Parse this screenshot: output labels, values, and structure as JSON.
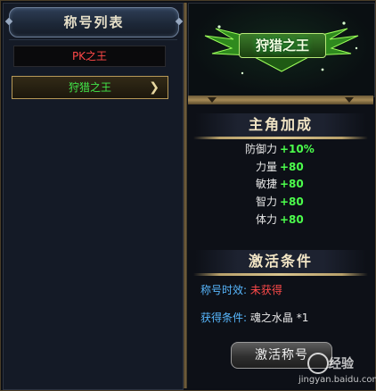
{
  "left_panel": {
    "title": "称号列表",
    "items": [
      {
        "label": "PK之王"
      },
      {
        "label": "狩猎之王",
        "arrow": "❯"
      }
    ]
  },
  "emblem": {
    "title": "狩猎之王"
  },
  "bonus": {
    "heading": "主角加成",
    "stats": [
      {
        "name": "防御力",
        "value": "+10%"
      },
      {
        "name": "力量",
        "value": "+80"
      },
      {
        "name": "敏捷",
        "value": "+80"
      },
      {
        "name": "智力",
        "value": "+80"
      },
      {
        "name": "体力",
        "value": "+80"
      }
    ]
  },
  "activation": {
    "heading": "激活条件",
    "status_label": "称号时效:",
    "status_value": "未获得",
    "requirement_label": "获得条件:",
    "requirement_value": "魂之水晶 *1",
    "button_label": "激活称号"
  },
  "watermark": {
    "text": "经验",
    "url": "jingyan.baidu.com"
  },
  "colors": {
    "stat_value": "#4cff4c",
    "label_blue": "#58b8ff",
    "status_red": "#ff4a4a",
    "selected_green": "#42e84a"
  }
}
